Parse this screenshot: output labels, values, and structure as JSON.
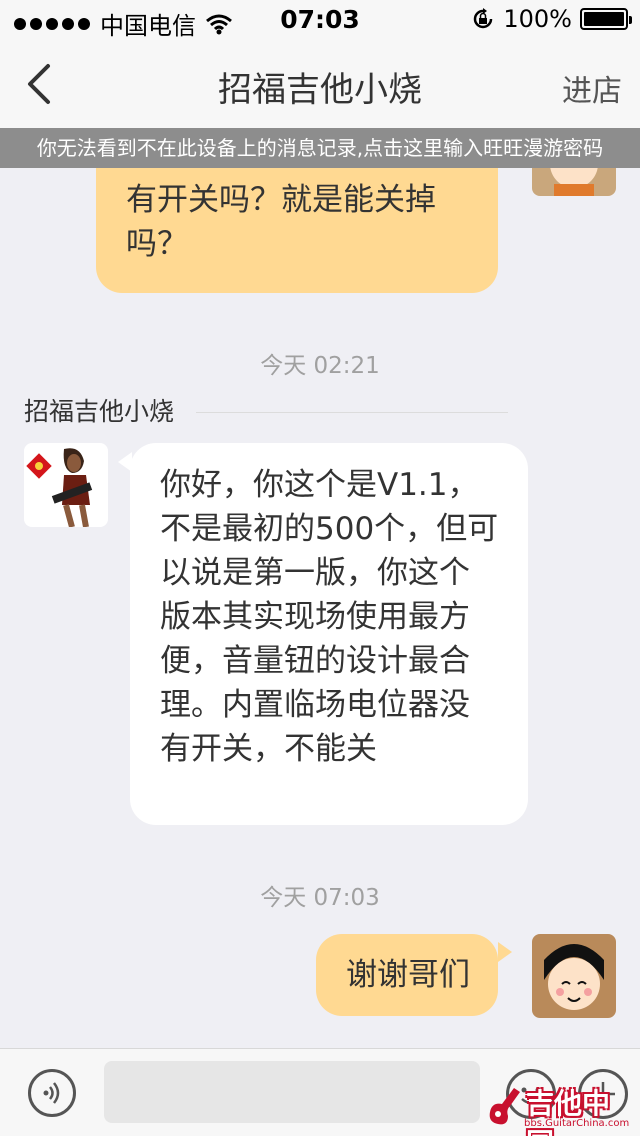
{
  "status_bar": {
    "carrier": "中国电信",
    "time": "07:03",
    "battery": "100%"
  },
  "nav": {
    "title": "招福吉他小烧",
    "shop_button": "进店"
  },
  "notice": "你无法看到不在此设备上的消息记录,点击这里输入旺旺漫游密码",
  "messages": {
    "first_mine": {
      "lines": [
        "有开关吗？就是能关掉",
        "吗？"
      ]
    },
    "time_1": "今天 02:21",
    "sender": "招福吉他小烧",
    "other": {
      "lines": [
        "你好，你这个是V1.1，",
        "不是最初的500个，但可",
        "以说是第一版，你这个",
        "版本其实现场使用最方",
        "便，音量钮的设计最合",
        "理。内置临场电位器没",
        "有开关，不能关"
      ]
    },
    "time_2": "今天 07:03",
    "last_mine": {
      "lines": [
        "谢谢哥们"
      ]
    }
  },
  "input": {
    "placeholder": ""
  },
  "watermark": {
    "text": "吉他中国",
    "url": "bbs.GuitarChina.com"
  },
  "colors": {
    "mine_bubble": "#ffd992",
    "other_bubble": "#ffffff",
    "background": "#efeff4"
  }
}
